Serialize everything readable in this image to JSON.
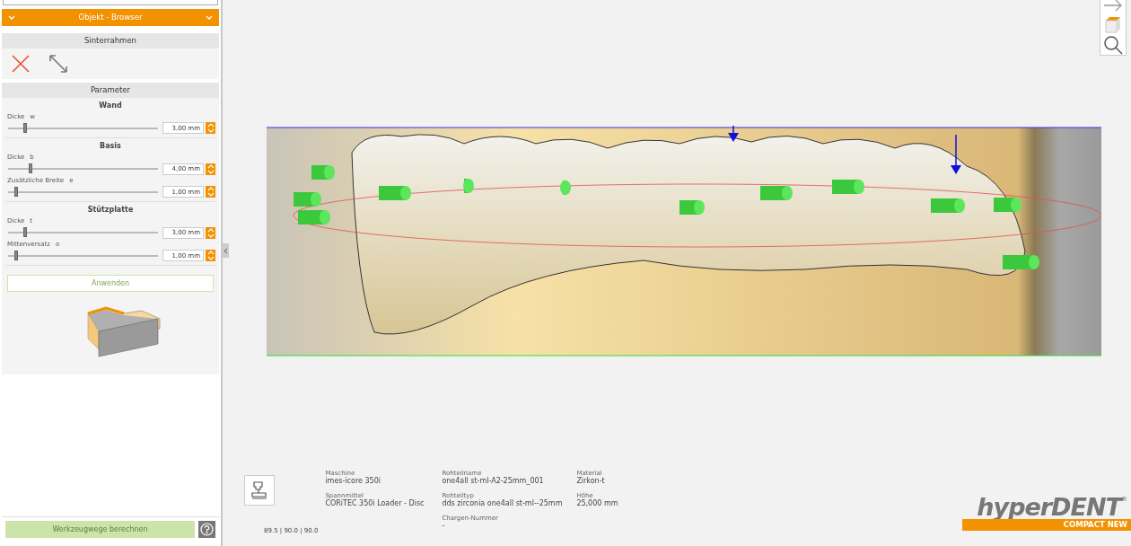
{
  "browser_panel": {
    "title": "Objekt - Browser",
    "expanded": true
  },
  "sinter_frame": {
    "title": "Sinterrahmen",
    "tools": [
      {
        "kind": "delete"
      },
      {
        "kind": "resize"
      }
    ]
  },
  "parameters": {
    "title": "Parameter",
    "groups": [
      {
        "title": "Wand",
        "rows": [
          {
            "label": "Dicke",
            "symbol": "w",
            "level": 0.1,
            "value": "3,00 mm"
          }
        ]
      },
      {
        "title": "Basis",
        "rows": [
          {
            "label": "Dicke",
            "symbol": "b",
            "level": 0.14,
            "value": "4,00 mm"
          },
          {
            "label": "Zusätzliche Breite",
            "symbol": "e",
            "level": 0.04,
            "value": "1,00 mm"
          }
        ]
      },
      {
        "title": "Stützplatte",
        "rows": [
          {
            "label": "Dicke",
            "symbol": "t",
            "level": 0.1,
            "value": "3,00 mm"
          },
          {
            "label": "Mittenversatz",
            "symbol": "o",
            "level": 0.04,
            "value": "1,00 mm"
          }
        ]
      }
    ]
  },
  "apply_button": {
    "label": "Anwenden",
    "disabled": true
  },
  "calculate_button": {
    "label": "Werkzeugwege berechnen",
    "disabled": true
  },
  "info": {
    "columns": [
      [
        {
          "label": "Maschine",
          "value": "imes-icore 350i"
        },
        {
          "label": "Spannmittel",
          "value": "CORiTEC 350i Loader - Disc"
        }
      ],
      [
        {
          "label": "Rohteilname",
          "value": "one4all st-ml-A2-25mm_001"
        },
        {
          "label": "Rohteiltyp",
          "value": "dds zirconia one4all st-ml--25mm"
        },
        {
          "label": "Chargen-Nummer",
          "value": "-"
        }
      ],
      [
        {
          "label": "Material",
          "value": "Zirkon-t"
        },
        {
          "label": "Höhe",
          "value": "25,000 mm"
        }
      ]
    ],
    "angles": "89.5 | 90.0 | 90.0"
  },
  "view_toolbar": [
    {
      "kind": "arrow"
    },
    {
      "kind": "cube"
    },
    {
      "kind": "search"
    }
  ],
  "logo": {
    "name": "hyperDENT",
    "mark": "®",
    "tagline": "COMPACT NEW"
  }
}
